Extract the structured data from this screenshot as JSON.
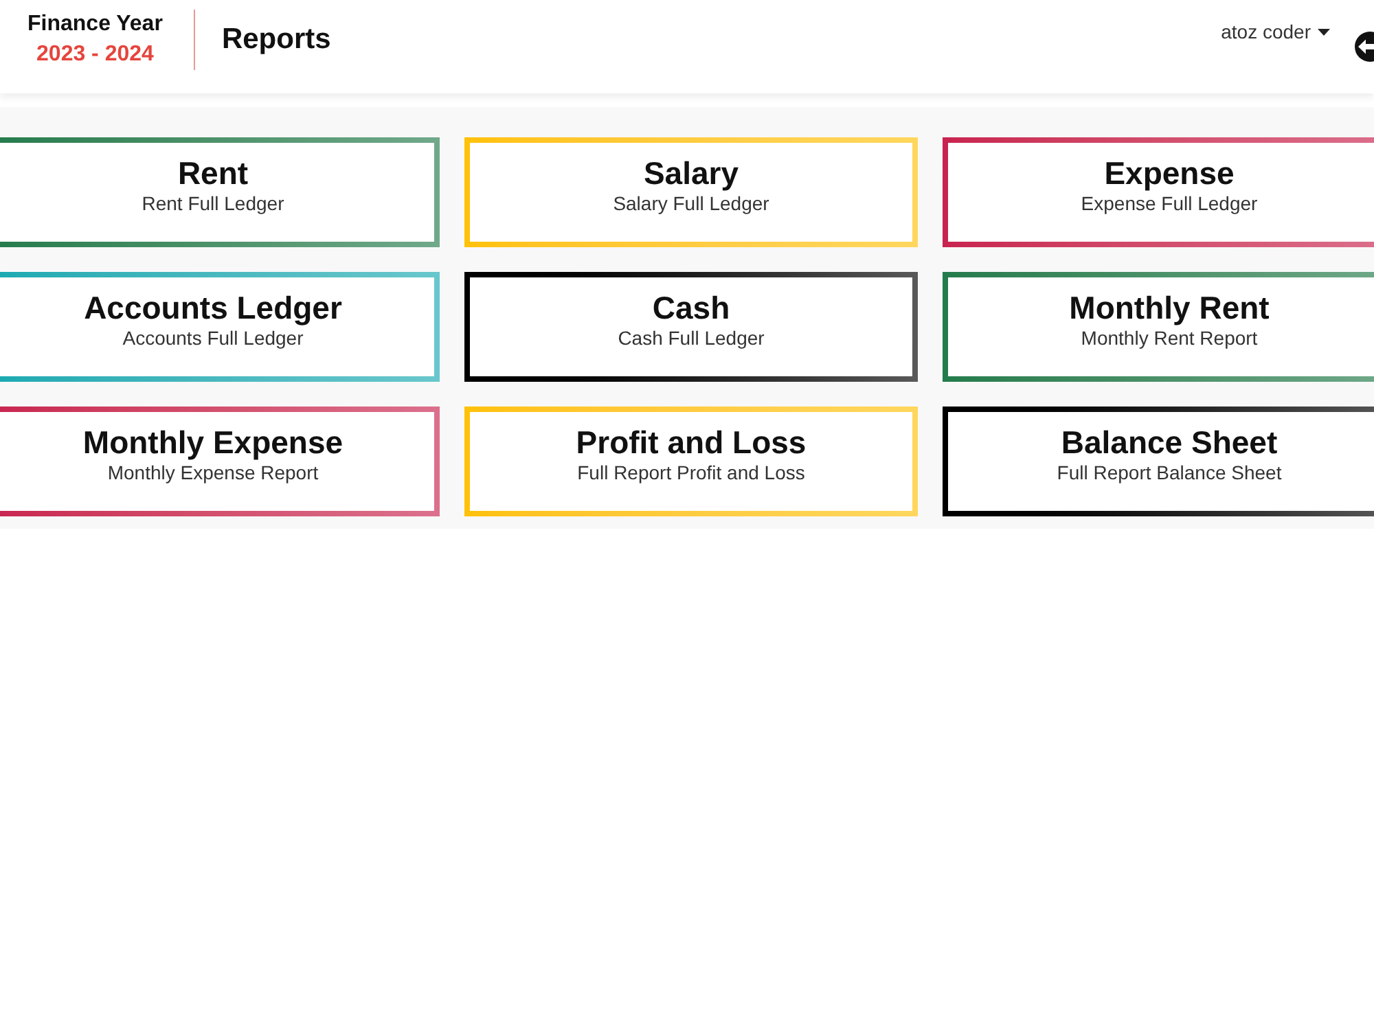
{
  "header": {
    "finance_year": {
      "label": "Finance Year",
      "range": "2023 - 2024"
    },
    "page_title": "Reports",
    "user_menu": {
      "name": "atoz coder"
    }
  },
  "report_cards": [
    {
      "title": "Rent",
      "subtitle": "Rent Full Ledger",
      "color": "#237b4b"
    },
    {
      "title": "Salary",
      "subtitle": "Salary Full Ledger",
      "color": "#ffc107"
    },
    {
      "title": "Expense",
      "subtitle": "Expense Full Ledger",
      "color": "#c8234f"
    },
    {
      "title": "Accounts Ledger",
      "subtitle": "Accounts Full Ledger",
      "color": "#17a9b1"
    },
    {
      "title": "Cash",
      "subtitle": "Cash Full Ledger",
      "color": "#000000"
    },
    {
      "title": "Monthly Rent",
      "subtitle": "Monthly Rent Report",
      "color": "#237b4b"
    },
    {
      "title": "Monthly Expense",
      "subtitle": "Monthly Expense Report",
      "color": "#c8234f"
    },
    {
      "title": "Profit and Loss",
      "subtitle": "Full Report Profit and Loss",
      "color": "#ffc107"
    },
    {
      "title": "Balance Sheet",
      "subtitle": "Full Report Balance Sheet",
      "color": "#000000"
    }
  ]
}
